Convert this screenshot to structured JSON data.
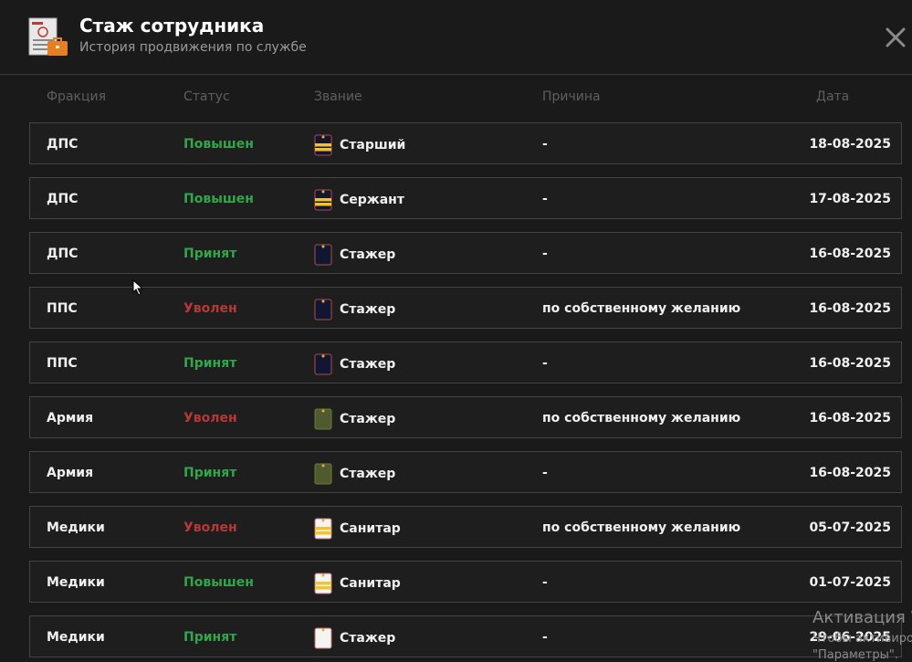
{
  "header": {
    "title": "Стаж сотрудника",
    "subtitle": "История продвижения по службе",
    "icon": "employee-record-icon",
    "close_icon": "close-icon"
  },
  "columns": {
    "faction": "Фракция",
    "status": "Статус",
    "rank": "Звание",
    "reason": "Причина",
    "date": "Дата"
  },
  "status_colors": {
    "promoted": "#32a64a",
    "accepted": "#32a64a",
    "fired": "#b83838"
  },
  "rows": [
    {
      "faction": "ДПС",
      "status": "Повышен",
      "status_kind": "promoted",
      "rank": "Старший",
      "rank_icon": "navy-stripes-insignia-icon",
      "reason": "-",
      "date": "18-08-2025"
    },
    {
      "faction": "ДПС",
      "status": "Повышен",
      "status_kind": "promoted",
      "rank": "Сержант",
      "rank_icon": "navy-stripes-insignia-icon",
      "reason": "-",
      "date": "17-08-2025"
    },
    {
      "faction": "ДПС",
      "status": "Принят",
      "status_kind": "accepted",
      "rank": "Стажер",
      "rank_icon": "navy-plain-insignia-icon",
      "reason": "-",
      "date": "16-08-2025"
    },
    {
      "faction": "ППС",
      "status": "Уволен",
      "status_kind": "fired",
      "rank": "Стажер",
      "rank_icon": "navy-plain-insignia-icon",
      "reason": "по собственному желанию",
      "date": "16-08-2025"
    },
    {
      "faction": "ППС",
      "status": "Принят",
      "status_kind": "accepted",
      "rank": "Стажер",
      "rank_icon": "navy-plain-insignia-icon",
      "reason": "-",
      "date": "16-08-2025"
    },
    {
      "faction": "Армия",
      "status": "Уволен",
      "status_kind": "fired",
      "rank": "Стажер",
      "rank_icon": "olive-plain-insignia-icon",
      "reason": "по собственному желанию",
      "date": "16-08-2025"
    },
    {
      "faction": "Армия",
      "status": "Принят",
      "status_kind": "accepted",
      "rank": "Стажер",
      "rank_icon": "olive-plain-insignia-icon",
      "reason": "-",
      "date": "16-08-2025"
    },
    {
      "faction": "Медики",
      "status": "Уволен",
      "status_kind": "fired",
      "rank": "Санитар",
      "rank_icon": "white-stripes-insignia-icon",
      "reason": "по собственному желанию",
      "date": "05-07-2025"
    },
    {
      "faction": "Медики",
      "status": "Повышен",
      "status_kind": "promoted",
      "rank": "Санитар",
      "rank_icon": "white-stripes-insignia-icon",
      "reason": "-",
      "date": "01-07-2025"
    },
    {
      "faction": "Медики",
      "status": "Принят",
      "status_kind": "accepted",
      "rank": "Стажер",
      "rank_icon": "white-plain-insignia-icon",
      "reason": "-",
      "date": "29-06-2025"
    }
  ],
  "os_watermark": {
    "line1": "Активация W",
    "line2": "Чтобы активиро",
    "line3": "\"Параметры\"."
  }
}
